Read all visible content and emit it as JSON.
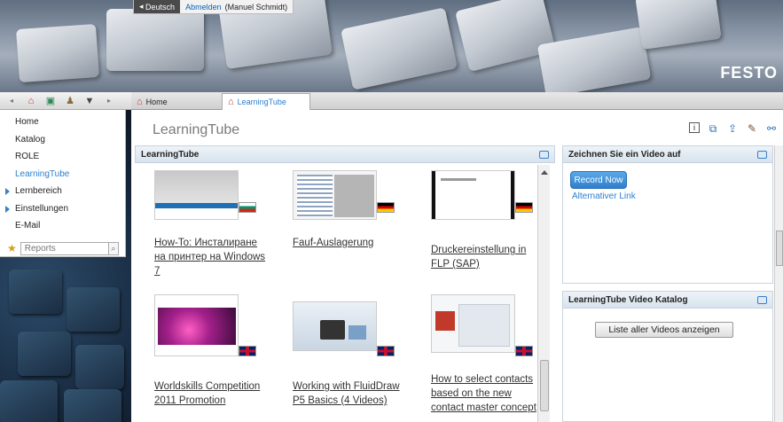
{
  "header": {
    "language_label": "Deutsch",
    "logout_label": "Abmelden",
    "user_label": "(Manuel Schmidt)",
    "brand": "FESTO"
  },
  "left_toolbar": {
    "icons": [
      "arrow-left-icon",
      "home-icon",
      "archive-icon",
      "people-icon",
      "graduation-cap-icon",
      "arrow-right-icon"
    ]
  },
  "left_menu": {
    "items": [
      {
        "label": "Home",
        "active": false,
        "expandable": false
      },
      {
        "label": "Katalog",
        "active": false,
        "expandable": false
      },
      {
        "label": "ROLE",
        "active": false,
        "expandable": false
      },
      {
        "label": "LearningTube",
        "active": true,
        "expandable": false
      },
      {
        "label": "Lernbereich",
        "active": false,
        "expandable": true
      },
      {
        "label": "Einstellungen",
        "active": false,
        "expandable": true
      },
      {
        "label": "E-Mail",
        "active": false,
        "expandable": false
      }
    ],
    "reports_placeholder": "Reports"
  },
  "tabs": [
    {
      "label": "Home",
      "active": false
    },
    {
      "label": "LearningTube",
      "active": true
    }
  ],
  "main": {
    "title": "LearningTube",
    "tool_icons": [
      "info-icon",
      "export-icon",
      "share-icon",
      "edit-icon",
      "network-icon"
    ],
    "learningtube_panel": {
      "header": "LearningTube",
      "videos": [
        {
          "title": "How-To: Инсталиране на принтер на Windows 7",
          "flag": "bg"
        },
        {
          "title": "Fauf-Auslagerung",
          "flag": "de"
        },
        {
          "title": "Druckereinstellung in FLP (SAP)",
          "flag": "de"
        },
        {
          "title": "Worldskills Competition 2011 Promotion",
          "flag": "uk"
        },
        {
          "title": "Working with FluidDraw P5 Basics (4 Videos)",
          "flag": "uk"
        },
        {
          "title": "How to select contacts based on the new contact master concept",
          "flag": "uk"
        }
      ]
    },
    "record_panel": {
      "header": "Zeichnen Sie ein Video auf",
      "record_label": "Record Now",
      "alt_link": "Alternativer Link"
    },
    "catalog_panel": {
      "header": "LearningTube Video Katalog",
      "show_all_label": "Liste aller Videos anzeigen"
    }
  },
  "colors": {
    "accent_blue": "#2a7fd0",
    "record_button": "#2e7fcd",
    "panel_header": "#d7e3ee"
  }
}
